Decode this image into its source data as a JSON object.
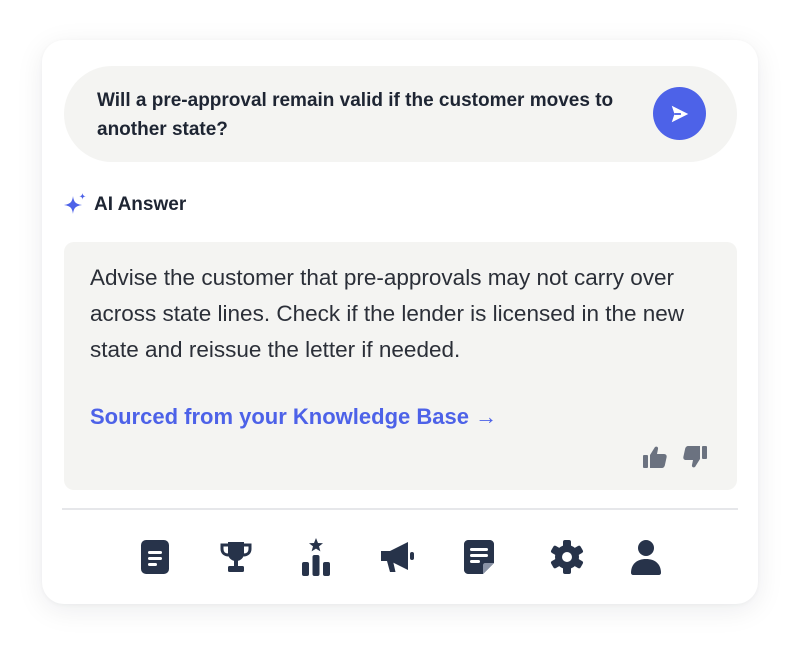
{
  "question": {
    "text": "Will a pre-approval remain valid if the customer moves to another state?",
    "send_icon": "send-icon"
  },
  "answer_header": {
    "label": "AI Answer",
    "icon": "sparkle-icon"
  },
  "answer": {
    "body": "Advise the customer that pre-approvals may not carry over across state lines. Check if the lender is licensed in the new state and reissue the letter if needed.",
    "source_link": "Sourced from your Knowledge Base →"
  },
  "feedback": {
    "up_icon": "thumbs-up-icon",
    "down_icon": "thumbs-down-icon"
  },
  "nav": {
    "items": [
      {
        "icon": "document-icon"
      },
      {
        "icon": "trophy-icon"
      },
      {
        "icon": "leaderboard-icon"
      },
      {
        "icon": "megaphone-icon"
      },
      {
        "icon": "notes-icon"
      },
      {
        "icon": "settings-icon"
      },
      {
        "icon": "user-icon"
      }
    ]
  },
  "colors": {
    "accent": "#4d62e8",
    "nav_icon": "#27334a",
    "feedback_icon": "#6b7280",
    "panel_bg": "#f4f4f2"
  }
}
